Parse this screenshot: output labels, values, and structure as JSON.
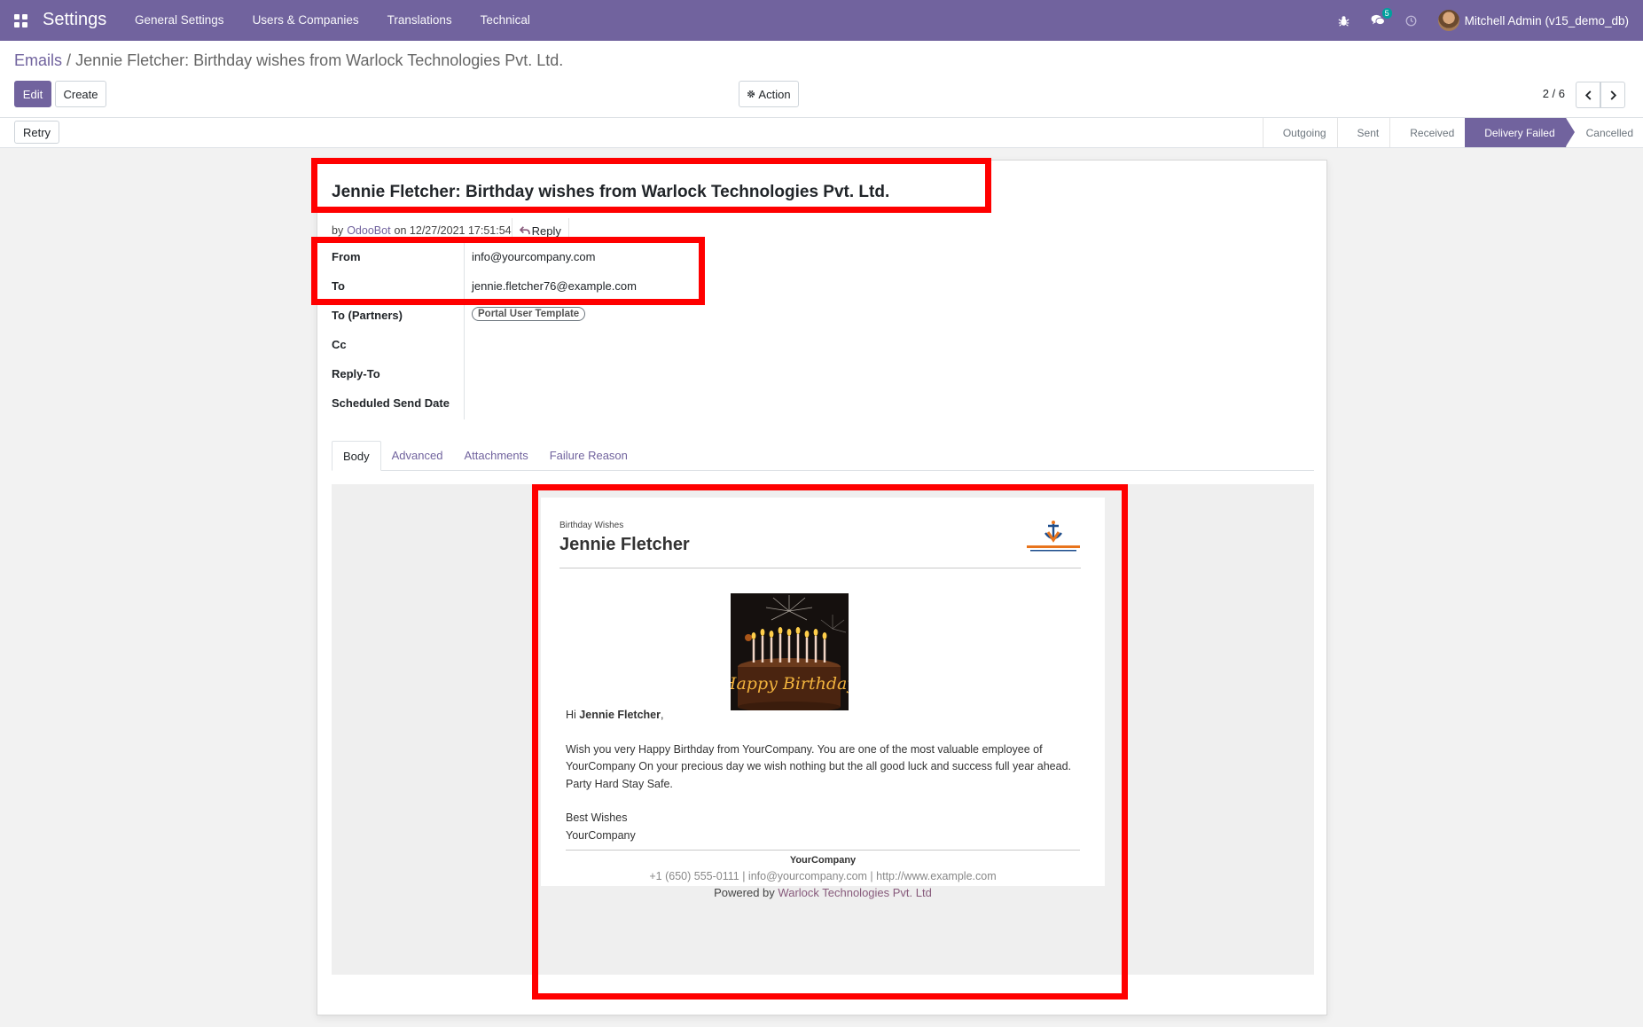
{
  "navbar": {
    "brand": "Settings",
    "menu": [
      "General Settings",
      "Users & Companies",
      "Translations",
      "Technical"
    ],
    "message_count": "5",
    "user": "Mitchell Admin (v15_demo_db)"
  },
  "control_panel": {
    "breadcrumb_parent": "Emails",
    "breadcrumb_separator": "/",
    "breadcrumb_current": "Jennie Fletcher: Birthday wishes from Warlock Technologies Pvt. Ltd.",
    "edit_label": "Edit",
    "create_label": "Create",
    "action_label": "Action",
    "pager": "2 / 6"
  },
  "statusbar": {
    "retry_label": "Retry",
    "stages": [
      "Outgoing",
      "Sent",
      "Received",
      "Delivery Failed",
      "Cancelled"
    ],
    "active_stage": "Delivery Failed"
  },
  "record": {
    "subject": "Jennie Fletcher: Birthday wishes from Warlock Technologies Pvt. Ltd.",
    "meta_by": "by",
    "author": "OdooBot",
    "meta_on": "on 12/27/2021 17:51:54",
    "reply_label": "Reply",
    "fields": [
      {
        "label": "From",
        "value": "info@yourcompany.com"
      },
      {
        "label": "To",
        "value": "jennie.fletcher76@example.com"
      },
      {
        "label": "To (Partners)",
        "value": "Portal User Template"
      },
      {
        "label": "Cc",
        "value": ""
      },
      {
        "label": "Reply-To",
        "value": ""
      },
      {
        "label": "Scheduled Send Date",
        "value": ""
      }
    ]
  },
  "tabs": [
    "Body",
    "Advanced",
    "Attachments",
    "Failure Reason"
  ],
  "active_tab": "Body",
  "mail": {
    "eyebrow": "Birthday Wishes",
    "name": "Jennie Fletcher",
    "greeting_prefix": "Hi",
    "greeting_name": "Jennie Fletcher",
    "greeting_suffix": ",",
    "paragraph": "Wish you very Happy Birthday from YourCompany. You are one of the most valuable employee of YourCompany On your precious day we wish nothing but the all good luck and success full year ahead.",
    "closing_line": "Party Hard Stay Safe.",
    "signoff": "Best Wishes",
    "signature": "YourCompany",
    "cake_text": "Happy Birthday",
    "footer_company": "YourCompany",
    "footer_contact": "+1 (650) 555-0111 | info@yourcompany.com | http://www.example.com",
    "powered_prefix": "Powered by",
    "powered_link": "Warlock Technologies Pvt. Ltd"
  },
  "colors": {
    "brand": "#71639e",
    "highlight": "#ff0000",
    "badge": "#00a09d"
  }
}
